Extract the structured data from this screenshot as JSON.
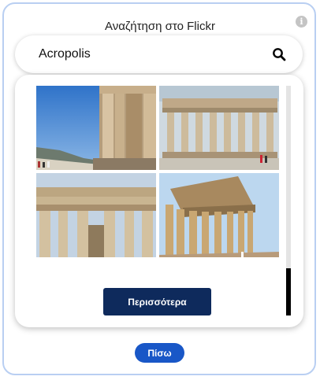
{
  "header": {
    "title": "Αναζήτηση στο Flickr",
    "info_icon": "info-icon"
  },
  "search": {
    "value": "Acropolis",
    "icon": "search-icon"
  },
  "results": {
    "photos": [
      {
        "subject": "parthenon-column-closeup"
      },
      {
        "subject": "parthenon-colonnade-front"
      },
      {
        "subject": "parthenon-facade-ruins"
      },
      {
        "subject": "parthenon-corner-view"
      }
    ],
    "more_label": "Περισσότερα"
  },
  "footer": {
    "back_label": "Πίσω"
  },
  "colors": {
    "panel_border": "#b9cff2",
    "more_button": "#0e2a5c",
    "back_button": "#1957c7",
    "scrollbar_thumb": "#000000"
  }
}
